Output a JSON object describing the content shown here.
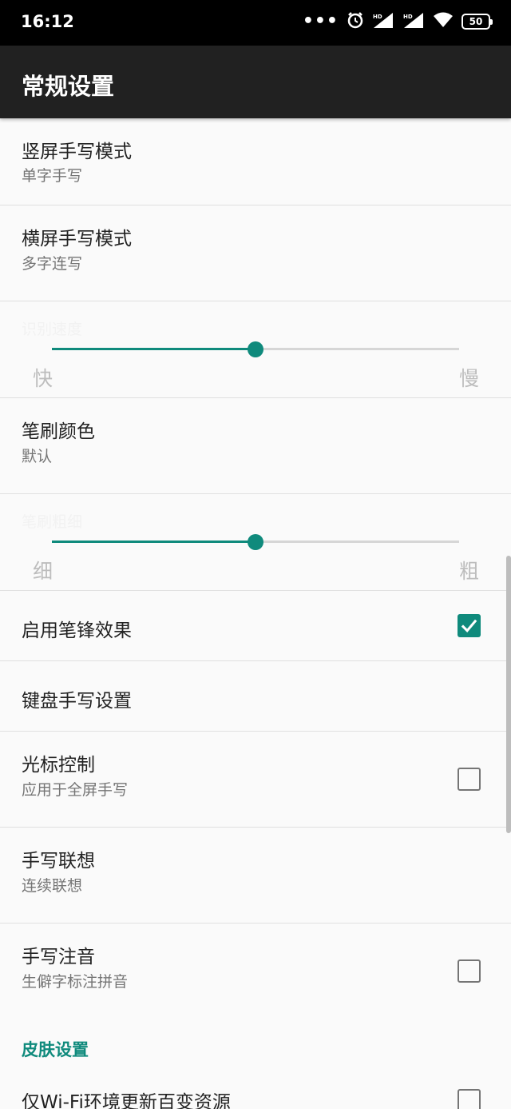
{
  "status_bar": {
    "time": "16:12",
    "dots": "•••",
    "battery": "50",
    "icons": [
      "more-dots-icon",
      "alarm-icon",
      "hd-signal-icon",
      "hd-signal-icon",
      "wifi-icon",
      "battery-icon"
    ]
  },
  "app_bar": {
    "title": "常规设置"
  },
  "settings": {
    "portrait_handwriting": {
      "title": "竖屏手写模式",
      "summary": "单字手写"
    },
    "landscape_handwriting": {
      "title": "横屏手写模式",
      "summary": "多字连写"
    },
    "recognition_speed": {
      "title": "识别速度",
      "min_label": "快",
      "max_label": "慢",
      "value": 0.5
    },
    "brush_color": {
      "title": "笔刷颜色",
      "summary": "默认"
    },
    "brush_thickness": {
      "title": "笔刷粗细",
      "min_label": "细",
      "max_label": "粗",
      "value": 0.5
    },
    "pen_tip_effect": {
      "title": "启用笔锋效果",
      "checked": true
    },
    "keyboard_handwriting": {
      "title": "键盘手写设置"
    },
    "cursor_control": {
      "title": "光标控制",
      "summary": "应用于全屏手写",
      "checked": false
    },
    "handwriting_prediction": {
      "title": "手写联想",
      "summary": "连续联想"
    },
    "handwriting_phonetic": {
      "title": "手写注音",
      "summary": "生僻字标注拼音",
      "checked": false
    },
    "skin_section": {
      "title": "皮肤设置"
    },
    "wifi_update_only": {
      "title": "仅Wi-Fi环境更新百变资源",
      "checked": false
    }
  },
  "colors": {
    "accent": "#0f8a7c",
    "appbar": "#212121",
    "statusbar": "#000000",
    "background": "#fafafa"
  }
}
